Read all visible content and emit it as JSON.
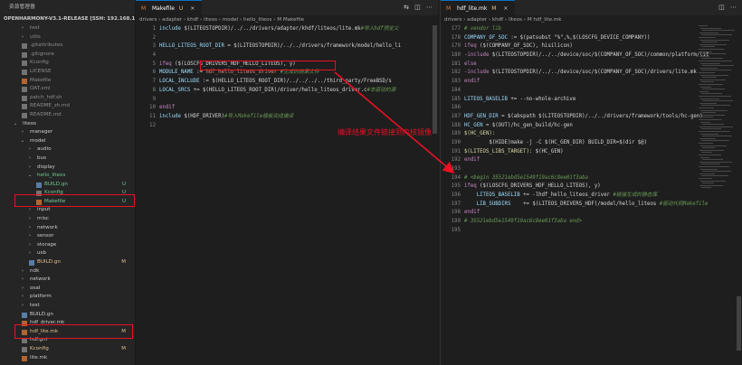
{
  "explorer": {
    "title": "资源管理器",
    "root_label": "OPENHARMONY-V3.1-RELEASE [SSH: 192.168.1.108]",
    "items": [
      {
        "label": "test",
        "depth": 1,
        "chev": "›",
        "color": "dim",
        "status": ""
      },
      {
        "label": "utils",
        "depth": 1,
        "chev": "›",
        "color": "dim",
        "status": ""
      },
      {
        "label": ".gitattributes",
        "depth": 1,
        "chev": "",
        "color": "dim",
        "status": ""
      },
      {
        "label": ".gitignore",
        "depth": 1,
        "chev": "",
        "color": "dim",
        "status": ""
      },
      {
        "label": "Kconfig",
        "depth": 1,
        "chev": "",
        "color": "dim",
        "status": ""
      },
      {
        "label": "LICENSE",
        "depth": 1,
        "chev": "",
        "color": "dim",
        "status": ""
      },
      {
        "label": "Makefile",
        "depth": 1,
        "chev": "",
        "color": "dim",
        "status": ""
      },
      {
        "label": "OAT.xml",
        "depth": 1,
        "chev": "",
        "color": "dim",
        "status": ""
      },
      {
        "label": "patch_hdf.sh",
        "depth": 1,
        "chev": "",
        "color": "dim",
        "status": ""
      },
      {
        "label": "README_zh.md",
        "depth": 1,
        "chev": "",
        "color": "dim",
        "status": ""
      },
      {
        "label": "README.md",
        "depth": 1,
        "chev": "",
        "color": "dim",
        "status": ""
      },
      {
        "label": "liteos",
        "depth": 0,
        "chev": "⌄",
        "color": "def",
        "status": ""
      },
      {
        "label": "manager",
        "depth": 1,
        "chev": "›",
        "color": "def",
        "status": ""
      },
      {
        "label": "model",
        "depth": 1,
        "chev": "⌄",
        "color": "def",
        "status": ""
      },
      {
        "label": "audio",
        "depth": 2,
        "chev": "›",
        "color": "def",
        "status": ""
      },
      {
        "label": "bus",
        "depth": 2,
        "chev": "›",
        "color": "def",
        "status": ""
      },
      {
        "label": "display",
        "depth": 2,
        "chev": "›",
        "color": "def",
        "status": ""
      },
      {
        "label": "hello_liteos",
        "depth": 2,
        "chev": "⌄",
        "color": "green",
        "status": ""
      },
      {
        "label": "BUILD.gn",
        "depth": 3,
        "chev": "",
        "color": "green",
        "status": "U"
      },
      {
        "label": "Kconfig",
        "depth": 3,
        "chev": "",
        "color": "green",
        "status": "U"
      },
      {
        "label": "Makefile",
        "depth": 3,
        "chev": "",
        "color": "green",
        "status": "U"
      },
      {
        "label": "input",
        "depth": 2,
        "chev": "›",
        "color": "def",
        "status": ""
      },
      {
        "label": "misc",
        "depth": 2,
        "chev": "›",
        "color": "def",
        "status": ""
      },
      {
        "label": "network",
        "depth": 2,
        "chev": "›",
        "color": "def",
        "status": ""
      },
      {
        "label": "sensor",
        "depth": 2,
        "chev": "›",
        "color": "def",
        "status": ""
      },
      {
        "label": "storage",
        "depth": 2,
        "chev": "›",
        "color": "def",
        "status": ""
      },
      {
        "label": "usb",
        "depth": 2,
        "chev": "›",
        "color": "def",
        "status": ""
      },
      {
        "label": "BUILD.gn",
        "depth": 2,
        "chev": "",
        "color": "orange",
        "status": "M"
      },
      {
        "label": "ndk",
        "depth": 1,
        "chev": "›",
        "color": "def",
        "status": ""
      },
      {
        "label": "network",
        "depth": 1,
        "chev": "›",
        "color": "def",
        "status": ""
      },
      {
        "label": "osal",
        "depth": 1,
        "chev": "›",
        "color": "def",
        "status": ""
      },
      {
        "label": "platform",
        "depth": 1,
        "chev": "›",
        "color": "def",
        "status": ""
      },
      {
        "label": "test",
        "depth": 1,
        "chev": "›",
        "color": "def",
        "status": ""
      },
      {
        "label": "BUILD.gn",
        "depth": 1,
        "chev": "",
        "color": "def",
        "status": ""
      },
      {
        "label": "hdf_driver.mk",
        "depth": 1,
        "chev": "",
        "color": "def",
        "status": ""
      },
      {
        "label": "hdf_lite.mk",
        "depth": 1,
        "chev": "",
        "color": "orange",
        "status": "M"
      },
      {
        "label": "hdf.gni",
        "depth": 1,
        "chev": "",
        "color": "def",
        "status": ""
      },
      {
        "label": "Kconfig",
        "depth": 1,
        "chev": "",
        "color": "orange",
        "status": "M"
      },
      {
        "label": "lite.mk",
        "depth": 1,
        "chev": "",
        "color": "def",
        "status": ""
      }
    ]
  },
  "left_editor": {
    "tab_label": "Makefile",
    "tab_status": "U",
    "tab_close": "×",
    "actions": "⇆ ◫ ⋯",
    "breadcrumb": "drivers › adapter › khdf › liteos › model › hello_liteos › M Makefile",
    "lines": [
      {
        "n": "1",
        "segs": [
          [
            "var",
            "include "
          ],
          [
            "def",
            "$(LITEOSTOPDIR)/../../drivers/adapter/khdf/liteos/lite.mk"
          ],
          [
            "com",
            "#导入hdf预定义"
          ]
        ]
      },
      {
        "n": "2",
        "segs": []
      },
      {
        "n": "3",
        "segs": [
          [
            "var",
            "HELLO_LITEOS_ROOT_DIR"
          ],
          [
            "def",
            " = $(LITEOSTOPDIR)/../../drivers/framework/model/hello_li"
          ]
        ]
      },
      {
        "n": "4",
        "segs": []
      },
      {
        "n": "5",
        "segs": [
          [
            "kw",
            "ifeq"
          ],
          [
            "def",
            " ($(LOSCFG_DRIVERS_HDF_HELLO_LITEOS), y)"
          ]
        ]
      },
      {
        "n": "6",
        "segs": [
          [
            "var",
            "MODULE_NAME"
          ],
          [
            "def",
            " := "
          ],
          [
            "str",
            "hdf_hello_liteos_driver"
          ],
          [
            "com",
            " #生成的结果文件"
          ]
        ]
      },
      {
        "n": "7",
        "segs": [
          [
            "var",
            "LOCAL_INCLUDE"
          ],
          [
            "def",
            " := $(HELLO_LITEOS_ROOT_DIR)/../../../../third_party/FreeBSD/s"
          ]
        ]
      },
      {
        "n": "8",
        "segs": [
          [
            "var",
            "LOCAL_SRCS"
          ],
          [
            "def",
            " += $(HELLO_LITEOS_ROOT_DIR)/driver/hello_liteos_driver.c"
          ],
          [
            "com",
            "#本驱动的源"
          ]
        ]
      },
      {
        "n": "9",
        "segs": []
      },
      {
        "n": "10",
        "segs": [
          [
            "kw",
            "endif"
          ]
        ]
      },
      {
        "n": "11",
        "segs": [
          [
            "var",
            "include "
          ],
          [
            "def",
            "$(HDF_DRIVER)"
          ],
          [
            "com",
            "#导入Makefile模板完成编译"
          ]
        ]
      },
      {
        "n": "12",
        "segs": []
      }
    ]
  },
  "right_editor": {
    "tab_label": "hdf_lite.mk",
    "tab_status": "M",
    "tab_close": "×",
    "actions": "◫ ⋯",
    "breadcrumb": "drivers › adapter › khdf › liteos › M hdf_lite.mk",
    "lines": [
      {
        "n": "177",
        "segs": [
          [
            "com",
            "# vendor lib"
          ]
        ]
      },
      {
        "n": "178",
        "segs": [
          [
            "var",
            "COMPANY_OF_SOC"
          ],
          [
            "def",
            " := $(patsubst \"%\",%,$(LOSCFG_DEVICE_COMPANY))"
          ]
        ]
      },
      {
        "n": "179",
        "segs": [
          [
            "kw",
            "ifeq"
          ],
          [
            "def",
            " ($(COMPANY_OF_SOC), hisilicon)"
          ]
        ]
      },
      {
        "n": "180",
        "segs": [
          [
            "kw",
            "-include"
          ],
          [
            "def",
            " $(LITEOSTOPDIR)/../../device/soc/$(COMPANY_OF_SOC)/common/platform/lit"
          ]
        ]
      },
      {
        "n": "181",
        "segs": [
          [
            "kw",
            "else"
          ]
        ]
      },
      {
        "n": "182",
        "segs": [
          [
            "kw",
            "-include"
          ],
          [
            "def",
            " $(LITEOSTOPDIR)/../../device/soc/$(COMPANY_OF_SOC)/drivers/lite.mk"
          ]
        ]
      },
      {
        "n": "183",
        "segs": [
          [
            "kw",
            "endif"
          ]
        ]
      },
      {
        "n": "184",
        "segs": []
      },
      {
        "n": "185",
        "segs": [
          [
            "var",
            "LITEOS_BASELIB"
          ],
          [
            "def",
            " += --no-whole-archive"
          ]
        ]
      },
      {
        "n": "186",
        "segs": []
      },
      {
        "n": "187",
        "segs": [
          [
            "var",
            "HDF_GEN_DIR"
          ],
          [
            "def",
            " = $(abspath $(LITEOSTOPDIR)/../../drivers/framework/tools/hc-gen)"
          ]
        ]
      },
      {
        "n": "188",
        "segs": [
          [
            "var",
            "HC_GEN"
          ],
          [
            "def",
            " = $(OUT)/hc_gen_build/hc-gen"
          ]
        ]
      },
      {
        "n": "189",
        "segs": [
          [
            "fn",
            "$(HC_GEN):"
          ]
        ]
      },
      {
        "n": "190",
        "segs": [
          [
            "def",
            "        $(HIDE)make -j -C $(HC_GEN_DIR) BUILD_DIR=$(dir $@)"
          ]
        ]
      },
      {
        "n": "191",
        "segs": [
          [
            "fn",
            "$(LITEOS_LIBS_TARGET):"
          ],
          [
            "def",
            " $(HC_GEN)"
          ]
        ]
      },
      {
        "n": "192",
        "segs": [
          [
            "kw",
            "endif"
          ]
        ]
      },
      {
        "n": "193",
        "segs": []
      },
      {
        "n": "194",
        "segs": [
          [
            "com",
            "# <begin 35521ebd5e1549f19ac6c8ee01f3aba"
          ]
        ]
      },
      {
        "n": "195",
        "segs": [
          [
            "kw",
            "ifeq"
          ],
          [
            "def",
            " ($(LOSCFG_DRIVERS_HDF_HELLO_LITEOS), y)"
          ]
        ]
      },
      {
        "n": "196",
        "segs": [
          [
            "var",
            "    LITEOS_BASELIB"
          ],
          [
            "def",
            " += -lhdf_hello_liteos_driver "
          ],
          [
            "com",
            "#链接生成的静态库"
          ]
        ]
      },
      {
        "n": "197",
        "segs": [
          [
            "var",
            "    LIB_SUBDIRS"
          ],
          [
            "def",
            "    += $(LITEOS_DRIVERS_HDF)/model/hello_liteos "
          ],
          [
            "com",
            "#驱动代码Makefile"
          ]
        ]
      },
      {
        "n": "198",
        "segs": [
          [
            "kw",
            "endif"
          ]
        ]
      },
      {
        "n": "199",
        "segs": [
          [
            "com",
            "# 35521ebd5e1549f19ac6c8ee01f3aba end>"
          ]
        ]
      },
      {
        "n": "195",
        "segs": []
      }
    ]
  },
  "annotation": {
    "text": "编译结果文件链接到内核镜像"
  },
  "colors": {
    "annotation": "#e81123",
    "accent": "#0e70c0"
  }
}
